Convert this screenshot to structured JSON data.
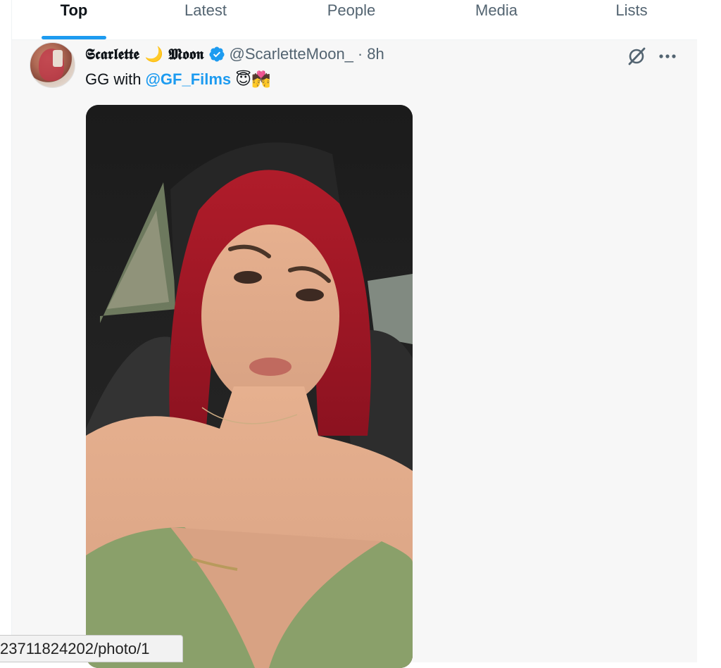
{
  "tabs": [
    {
      "label": "Top",
      "active": true
    },
    {
      "label": "Latest",
      "active": false
    },
    {
      "label": "People",
      "active": false
    },
    {
      "label": "Media",
      "active": false
    },
    {
      "label": "Lists",
      "active": false
    }
  ],
  "tweet": {
    "display_name": "𝕾𝖈𝖆𝖗𝖑𝖊𝖙𝖙𝖊 🌙 𝕸𝖔𝖔𝖓",
    "handle": "@ScarletteMoon_",
    "separator": "·",
    "time": "8h",
    "verified": true,
    "text_prefix": "GG with",
    "mention": "@GF_Films",
    "emojis": "😇💏",
    "media_alt": "Image"
  },
  "statusbar": {
    "url": "23711824202/photo/1"
  },
  "colors": {
    "accent": "#1d9bf0",
    "text_primary": "#0f1419",
    "text_secondary": "#536471"
  },
  "icons": [
    "grok-icon",
    "more-icon",
    "verified-badge-icon"
  ]
}
